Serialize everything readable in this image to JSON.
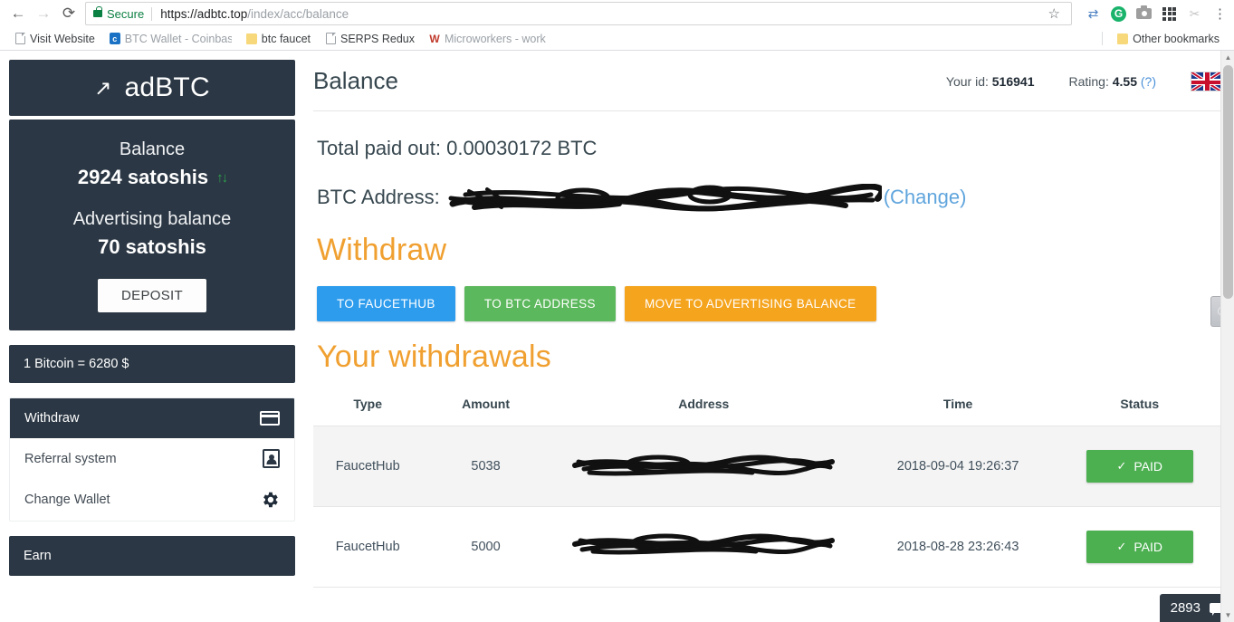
{
  "browser": {
    "back_icon": "back-arrow-icon",
    "forward_icon": "forward-arrow-icon",
    "reload_icon": "reload-icon",
    "security_label": "Secure",
    "url_host": "https://adbtc.top",
    "url_path": "/index/acc/balance",
    "star_glyph": "☆",
    "menu_glyph": "⋮",
    "bookmarks": [
      {
        "label": "Visit Website",
        "icon": "page-icon"
      },
      {
        "label": "BTC Wallet - Coinbas",
        "icon": "coinbase-icon",
        "icon_text": "c"
      },
      {
        "label": "btc faucet",
        "icon": "folder-icon"
      },
      {
        "label": "SERPS Redux",
        "icon": "page-icon"
      },
      {
        "label": "Microworkers - work",
        "icon": "microworkers-icon",
        "icon_text": "W"
      }
    ],
    "other_bookmarks": "Other bookmarks"
  },
  "sidebar": {
    "brand": {
      "arrow": "↗",
      "name": "adBTC"
    },
    "balance": {
      "label": "Balance",
      "value": "2924 satoshis",
      "exchange_icon": "exchange-arrows-icon",
      "ad_label": "Advertising balance",
      "ad_value": "70 satoshis",
      "deposit_label": "DEPOSIT"
    },
    "rate": "1 Bitcoin = 6280 $",
    "menu_withdraw": {
      "head": {
        "label": "Withdraw",
        "icon": "credit-card-icon"
      },
      "items": [
        {
          "label": "Referral system",
          "icon": "contact-card-icon"
        },
        {
          "label": "Change Wallet",
          "icon": "gear-icon"
        }
      ]
    },
    "menu_earn": {
      "head": {
        "label": "Earn"
      }
    }
  },
  "main": {
    "title": "Balance",
    "your_id_label": "Your id:",
    "your_id_value": "516941",
    "rating_label": "Rating:",
    "rating_value": "4.55",
    "rating_help": "(?)",
    "flag": "uk-flag-icon",
    "total_paid_out": "Total paid out: 0.00030172 BTC",
    "btc_address_label": "BTC Address:",
    "btc_address_value": "",
    "change_link": "(Change)",
    "withdraw_title": "Withdraw",
    "withdraw_buttons": [
      {
        "label": "TO FAUCETHUB",
        "color": "#2d9ced"
      },
      {
        "label": "TO BTC ADDRESS",
        "color": "#5cb85c"
      },
      {
        "label": "MOVE TO ADVERTISING BALANCE",
        "color": "#f5a41e"
      }
    ],
    "withdrawals_title": "Your withdrawals",
    "table": {
      "columns": [
        "Type",
        "Amount",
        "Address",
        "Time",
        "Status"
      ],
      "rows": [
        {
          "type": "FaucetHub",
          "amount": "5038",
          "address": "",
          "time": "2018-09-04 19:26:37",
          "status": "PAID",
          "status_check": "✓"
        },
        {
          "type": "FaucetHub",
          "amount": "5000",
          "address": "",
          "time": "2018-08-28 23:26:43",
          "status": "PAID",
          "status_check": "✓"
        }
      ]
    }
  },
  "overlays": {
    "chat_badge_count": "2893",
    "chat_badge_icon": "chat-bubble-icon",
    "side_tab_icon": "feedback-tab-icon"
  }
}
